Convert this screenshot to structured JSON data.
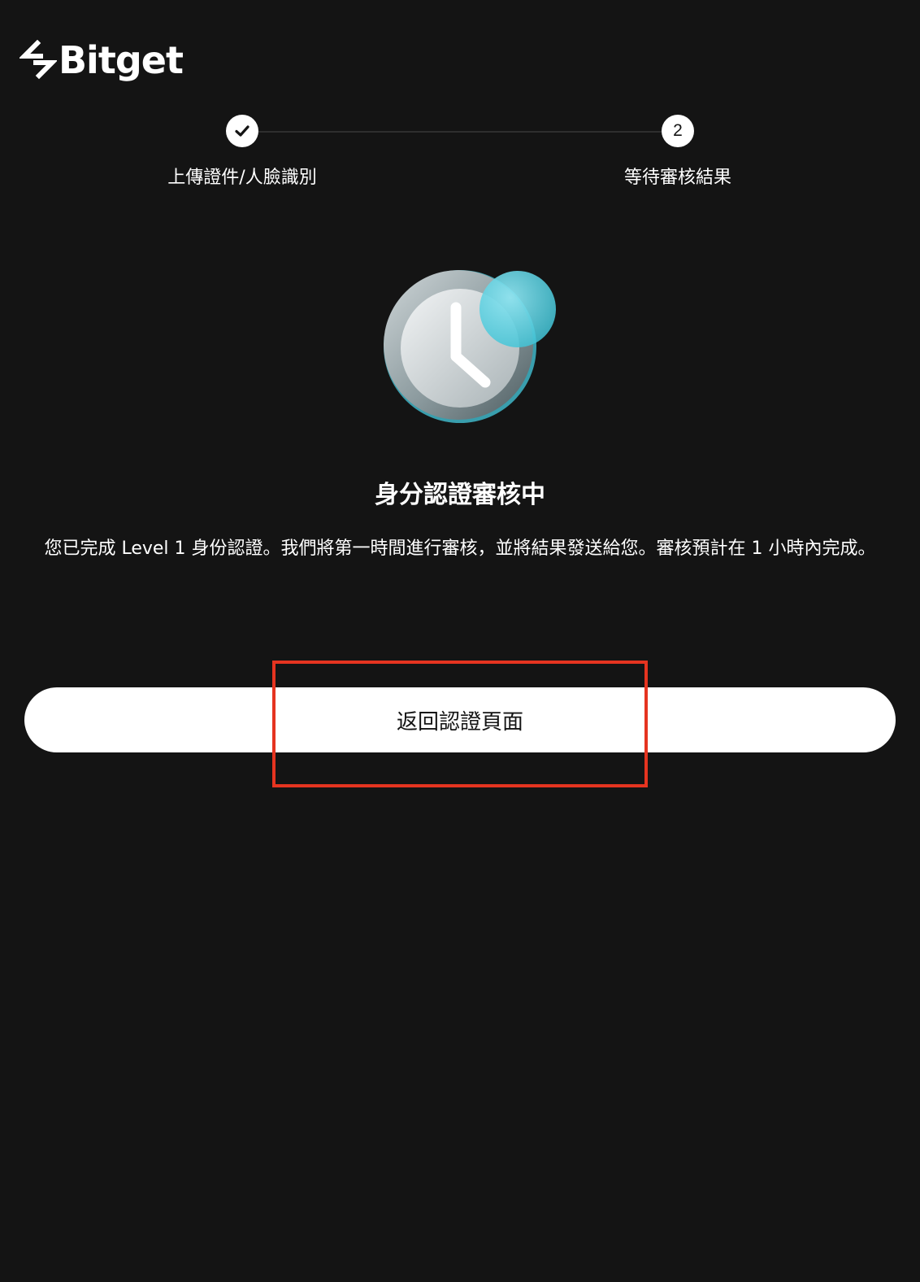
{
  "brand": {
    "name": "Bitget",
    "logo_icon": "bitget-logo-icon"
  },
  "stepper": {
    "steps": [
      {
        "marker": "check-icon",
        "label": "上傳證件/人臉識別",
        "status": "done"
      },
      {
        "marker": "2",
        "label": "等待審核結果",
        "status": "current"
      }
    ]
  },
  "status": {
    "icon": "clock-icon",
    "title": "身分認證審核中",
    "description": "您已完成 Level 1 身份認證。我們將第一時間進行審核，並將結果發送給您。審核預計在 1 小時內完成。"
  },
  "actions": {
    "back_label": "返回認證頁面"
  },
  "colors": {
    "background": "#141414",
    "text": "#ffffff",
    "button_bg": "#ffffff",
    "button_text": "#141414",
    "accent_cyan": "#5fd3e4",
    "annotation_red": "#e53420"
  }
}
